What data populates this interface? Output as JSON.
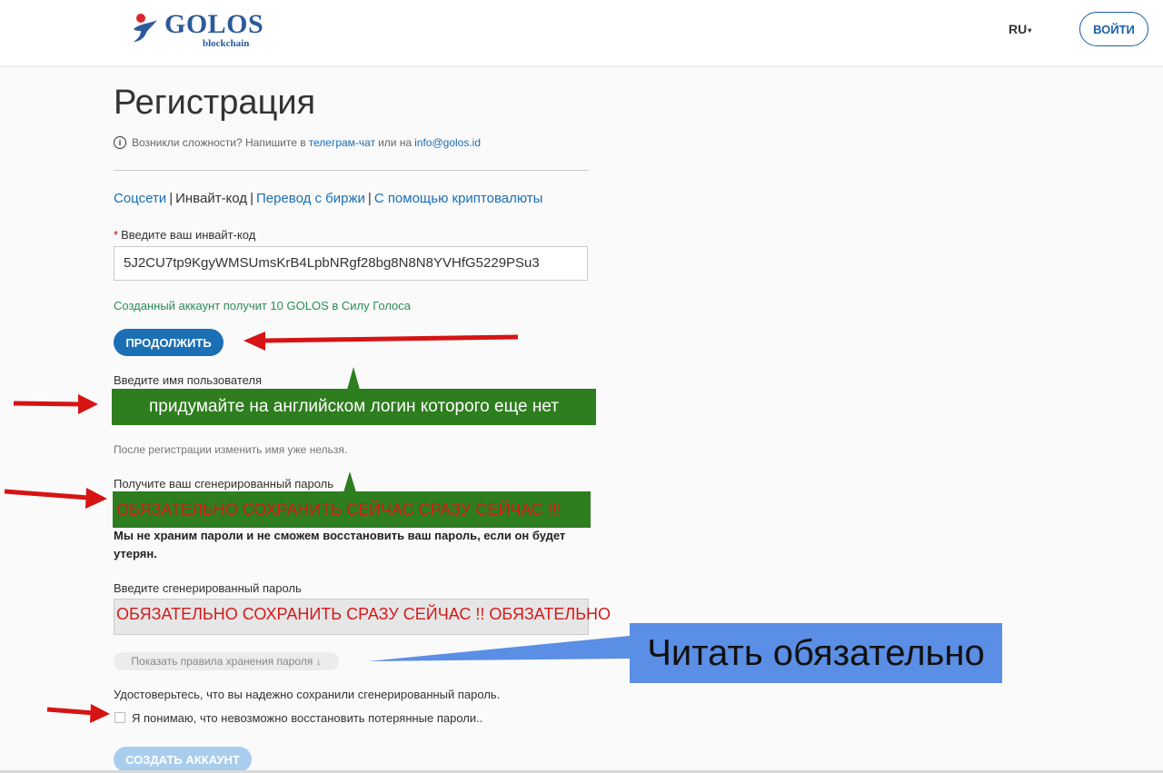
{
  "header": {
    "logo_title": "GOLOS",
    "logo_sub": "blockchain",
    "lang": "RU",
    "login_label": "ВОЙТИ"
  },
  "page": {
    "title": "Регистрация",
    "help_prefix": "Возникли сложности? Напишите в",
    "help_link1": "телеграм-чат",
    "help_mid": "или на",
    "help_link2": "info@golos.id",
    "methods": [
      "Соцсети",
      "Инвайт-код",
      "Перевод с биржи",
      "С помощью криптовалюты"
    ],
    "methods_sep": "|",
    "invite_label": "Введите ваш инвайт-код",
    "invite_value": "5J2CU7tp9KgyWMSUmsKrB4LpbNRgf28bg8N8N8YVHfG5229PSu3",
    "invite_note": "Созданный аккаунт получит 10 GOLOS в Силу Голоса",
    "continue_label": "ПРОДОЛЖИТЬ",
    "username_label": "Введите имя пользователя",
    "username_note": "После регистрации изменить имя уже нельзя.",
    "password_label": "Получите ваш сгенерированный пароль",
    "password_warning": "Мы не храним пароли и не сможем восстановить ваш пароль, если он будет утерян.",
    "confirm_label": "Введите сгенерированный пароль",
    "rules_label": "Показать правила хранения пароля ↓",
    "ensure_text": "Удостоверьтесь, что вы надежно сохранили сгенерированный пароль.",
    "checkbox_label": "Я понимаю, что невозможно восстановить потерянные пароли..",
    "create_label": "СОЗДАТЬ АККАУНТ"
  },
  "annotations": {
    "callout_username": "придумайте на английском логин которого еще нет",
    "callout_password": "ОБЯЗАТЕЛЬНО СОХРАНИТЬ СЕЙЧАС СРАЗУ СЕЙЧАС !!!",
    "overlay_confirm": "ОБЯЗАТЕЛЬНО СОХРАНИТЬ СРАЗУ СЕЙЧАС !! ОБЯЗАТЕЛЬНО",
    "read_box": "Читать обязательно",
    "arrow_color": "#d61414",
    "callout_color": "#2e7d1e",
    "box_color": "#5b8ee5"
  }
}
